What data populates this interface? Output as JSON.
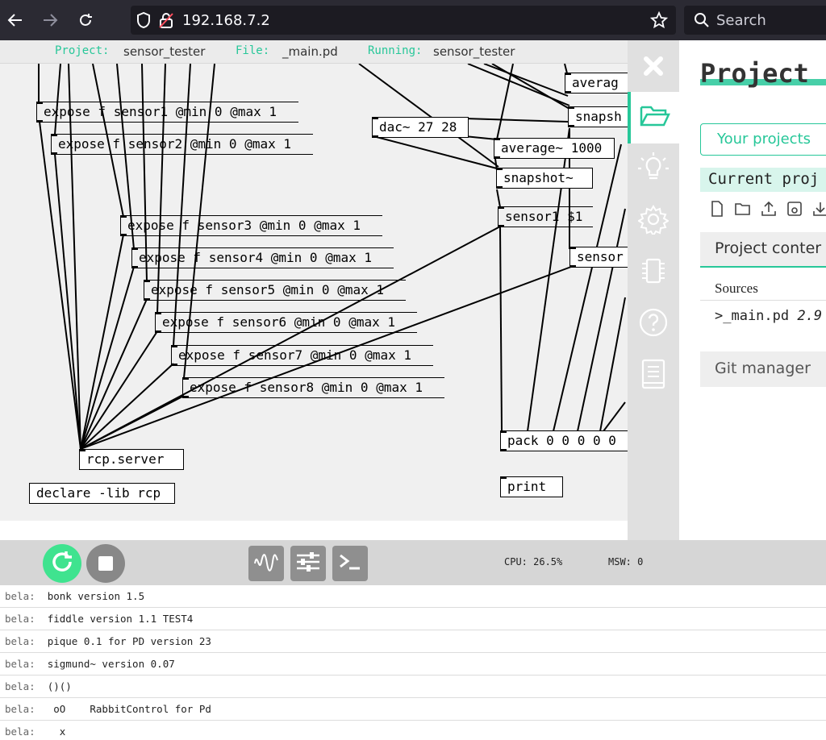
{
  "browser": {
    "url": "192.168.7.2",
    "search_placeholder": "Search"
  },
  "info_bar": {
    "project_key": "Project:",
    "project_val": "sensor_tester",
    "file_key": "File:",
    "file_val": "_main.pd",
    "running_key": "Running:",
    "running_val": "sensor_tester"
  },
  "patch": {
    "objects": [
      "expose f sensor1 @min 0 @max 1",
      "expose f sensor2 @min 0 @max 1",
      "expose f sensor3 @min 0 @max 1",
      "expose f sensor4 @min 0 @max 1",
      "expose f sensor5 @min 0 @max 1",
      "expose f sensor6 @min 0 @max 1",
      "expose f sensor7 @min 0 @max 1",
      "expose f sensor8 @min 0 @max 1",
      "rcp.server",
      "declare -lib rcp",
      "dac~ 27 28",
      "average~ 1000",
      "snapshot~",
      "sensor1 $1",
      "averag",
      "snapsh",
      "sensor",
      "pack 0 0 0 0 0",
      "print"
    ]
  },
  "panel": {
    "title": "Project",
    "your_projects": "Your projects",
    "current_project": "Current proj",
    "project_contents": "Project conter",
    "sources_label": "Sources",
    "source_file_name": ">_main.pd",
    "source_file_size": "2.9",
    "git_manager": "Git manager"
  },
  "toolbar": {
    "cpu": "CPU: 26.5%",
    "msw": "MSW: 0"
  },
  "console": {
    "lines": [
      {
        "src": "bela:",
        "msg": "bonk version 1.5"
      },
      {
        "src": "bela:",
        "msg": "fiddle version 1.1 TEST4"
      },
      {
        "src": "bela:",
        "msg": "pique 0.1 for PD version 23"
      },
      {
        "src": "bela:",
        "msg": "sigmund~ version 0.07"
      },
      {
        "src": "bela:",
        "msg": "()()"
      },
      {
        "src": "bela:",
        "msg": " oO    RabbitControl for Pd"
      },
      {
        "src": "bela:",
        "msg": "  x"
      }
    ]
  },
  "colors": {
    "accent": "#27c799",
    "browser_bg": "#2b2a33",
    "canvas_bg": "#f0f0f0",
    "run_green": "#3fe38f"
  }
}
